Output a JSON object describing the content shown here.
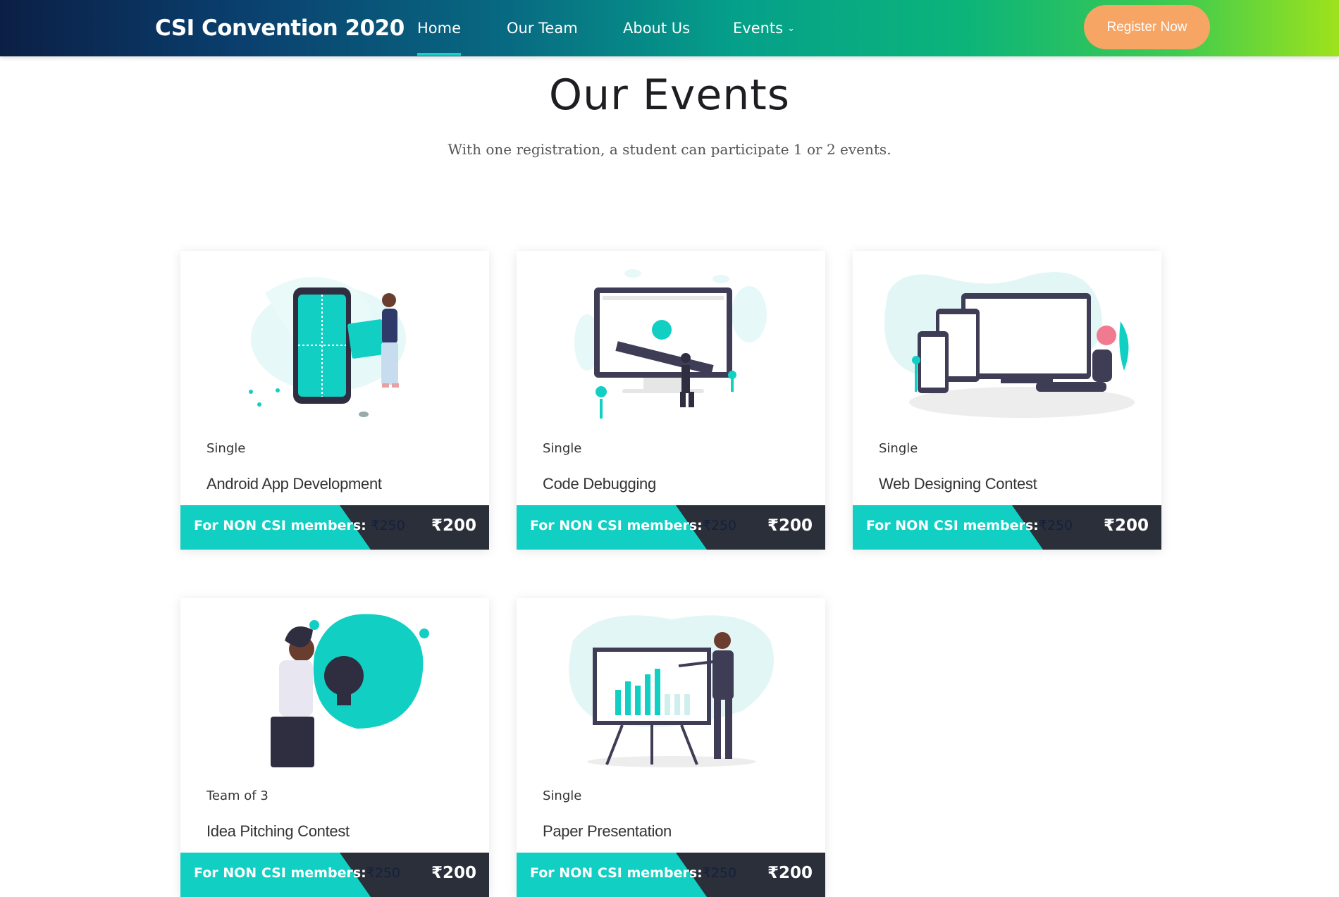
{
  "header": {
    "brand": "CSI Convention 2020",
    "nav": [
      {
        "label": "Home"
      },
      {
        "label": "Our Team"
      },
      {
        "label": "About Us"
      },
      {
        "label": "Events"
      }
    ],
    "register_label": "Register Now"
  },
  "section": {
    "title": "Our Events",
    "subtitle": "With one registration, a student can participate 1 or 2 events."
  },
  "events": [
    {
      "type": "Single",
      "title": "Android App Development",
      "non_csi_label": "For NON CSI members: ",
      "non_csi_price": "₹250",
      "csi_price": "₹200",
      "illustration": "phone-puzzle-illustration"
    },
    {
      "type": "Single",
      "title": "Code Debugging",
      "non_csi_label": "For NON CSI members:",
      "non_csi_price": "₹250",
      "csi_price": "₹200",
      "illustration": "monitor-bug-illustration"
    },
    {
      "type": "Single",
      "title": "Web Designing Contest",
      "non_csi_label": "For NON CSI members:",
      "non_csi_price": "₹250",
      "csi_price": "₹200",
      "illustration": "responsive-devices-illustration"
    },
    {
      "type": "Team of 3",
      "title": "Idea Pitching Contest",
      "non_csi_label": "For NON CSI members:",
      "non_csi_price": "₹250",
      "csi_price": "₹200",
      "illustration": "lightbulb-idea-illustration"
    },
    {
      "type": "Single",
      "title": "Paper Presentation",
      "non_csi_label": "For NON CSI members:",
      "non_csi_price": "₹250",
      "csi_price": "₹200",
      "illustration": "presentation-board-illustration"
    }
  ],
  "colors": {
    "accent": "#12cfc3",
    "dark": "#2a2f3a",
    "register": "#f7a564"
  }
}
